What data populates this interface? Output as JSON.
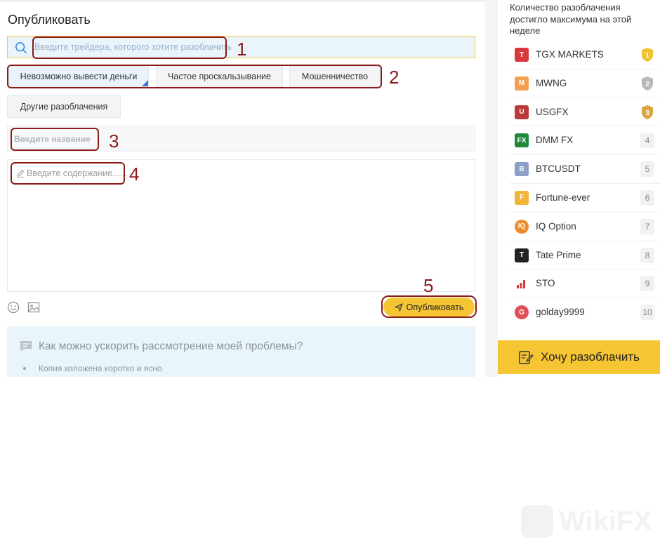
{
  "page": {
    "title": "Опубликовать"
  },
  "search": {
    "placeholder": "Введите трейдера, которого хотите разоблачить"
  },
  "categories": [
    {
      "label": "Невозможно вывести деньги",
      "active": true
    },
    {
      "label": "Частое проскальзывание",
      "active": false
    },
    {
      "label": "Мошенничество",
      "active": false
    },
    {
      "label": "Другие разоблачения",
      "active": false
    }
  ],
  "form": {
    "title_placeholder": "Введите название",
    "content_placeholder": "Введите содержание......",
    "publish_label": "Опубликовать"
  },
  "help": {
    "question": "Как можно ускорить рассмотрение моей проблемы?",
    "tip": "Копия изложена коротко и ясно"
  },
  "annotations": [
    "1",
    "2",
    "3",
    "4",
    "5"
  ],
  "sidebar": {
    "heading": "Количество разоблачения достигло максимума на этой неделе",
    "items": [
      {
        "name": "TGX MARKETS",
        "rank": "1",
        "color": "#d9363e",
        "glyph": "T"
      },
      {
        "name": "MWNG",
        "rank": "2",
        "color": "#f0a050",
        "glyph": "M"
      },
      {
        "name": "USGFX",
        "rank": "3",
        "color": "#b83a3a",
        "glyph": "U"
      },
      {
        "name": "DMM FX",
        "rank": "4",
        "color": "#1f8a3b",
        "glyph": "FX"
      },
      {
        "name": "BTCUSDT",
        "rank": "5",
        "color": "#8aa0c8",
        "glyph": "B"
      },
      {
        "name": "Fortune-ever",
        "rank": "6",
        "color": "#f3b43a",
        "glyph": "F"
      },
      {
        "name": "IQ Option",
        "rank": "7",
        "color": "#f08a2a",
        "glyph": "IQ"
      },
      {
        "name": "Tate Prime",
        "rank": "8",
        "color": "#222222",
        "glyph": "T"
      },
      {
        "name": "STO",
        "rank": "9",
        "color": "#ffffff",
        "glyph": ""
      },
      {
        "name": "golday9999",
        "rank": "10",
        "color": "#e0505a",
        "glyph": "G"
      }
    ],
    "medal_colors": [
      "#f1c232",
      "#b8b8b8",
      "#d9a441"
    ],
    "cta_label": "Хочу разоблачить"
  },
  "watermark": "WikiFX"
}
